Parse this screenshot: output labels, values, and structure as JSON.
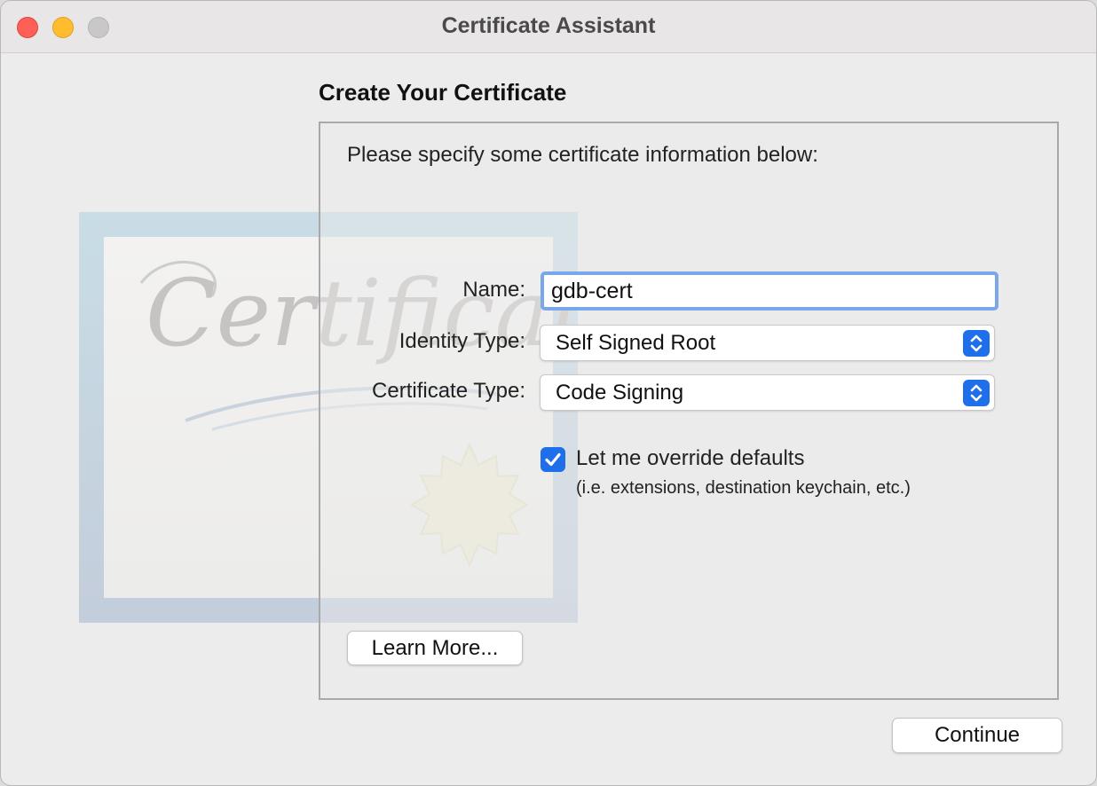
{
  "window": {
    "title": "Certificate Assistant"
  },
  "page": {
    "heading": "Create Your Certificate",
    "instructions": "Please specify some certificate information below:"
  },
  "form": {
    "name_label": "Name:",
    "name_value": "gdb-cert",
    "identity_type_label": "Identity Type:",
    "identity_type_value": "Self Signed Root",
    "certificate_type_label": "Certificate Type:",
    "certificate_type_value": "Code Signing",
    "override_label": "Let me override defaults",
    "override_sublabel": "(i.e. extensions, destination keychain, etc.)",
    "override_checked": true
  },
  "buttons": {
    "learn_more": "Learn More...",
    "continue": "Continue"
  },
  "artwork": {
    "certificate_word": "Certificate"
  },
  "colors": {
    "accent": "#1f6feb",
    "focus_ring": "#7aa6ea",
    "close": "#fe5f57",
    "minimize": "#febc2e",
    "zoom_disabled": "#c8c8c8"
  },
  "icons": {
    "close": "close-dot-icon",
    "minimize": "minimize-dot-icon",
    "zoom": "zoom-dot-icon",
    "popup_arrows": "chevron-up-down-icon",
    "checkmark": "checkmark-icon"
  }
}
